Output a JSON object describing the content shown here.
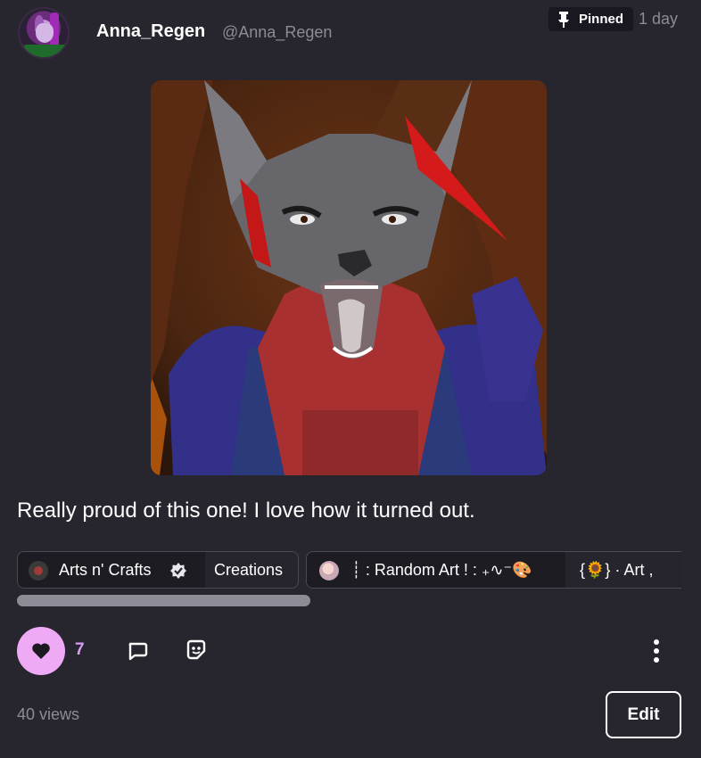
{
  "post": {
    "author_name": "Anna_Regen",
    "author_handle": "@Anna_Regen",
    "pinned_label": "Pinned",
    "time_ago": "1 day",
    "caption": "Really proud of this one!  I love how it turned out."
  },
  "tags": [
    {
      "name": "Arts n' Crafts",
      "sub": "Creations",
      "verified": true,
      "icon": "arts-community-icon"
    },
    {
      "name": "┊ : Random Art ! : ₊∿⁻🎨",
      "sub": "{🌻} · Art ,",
      "icon": "random-art-community-icon"
    }
  ],
  "actions": {
    "like_count": "7",
    "views": "40 views",
    "edit_label": "Edit"
  },
  "icons": [
    "pin-icon",
    "heart-icon",
    "comment-icon",
    "sticker-icon",
    "more-icon",
    "verified-icon"
  ],
  "colors": {
    "background": "#27262f",
    "like_button": "#efaaf6",
    "like_count": "#d89bf6",
    "muted_text": "#8d8c96"
  }
}
